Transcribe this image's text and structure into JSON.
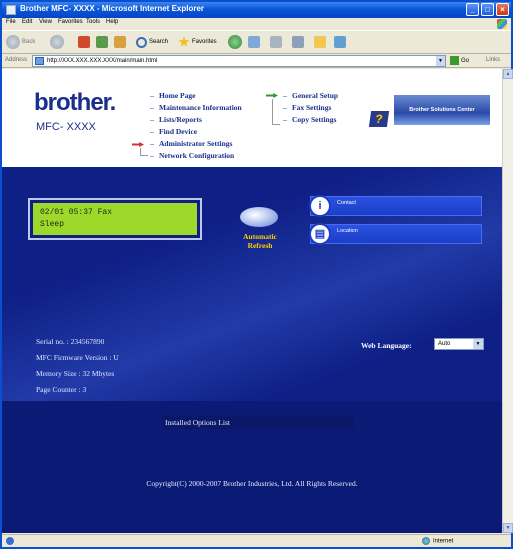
{
  "window": {
    "title": "Brother MFC- XXXX - Microsoft Internet Explorer"
  },
  "menu": [
    "File",
    "Edit",
    "View",
    "Favorites",
    "Tools",
    "Help"
  ],
  "toolbar": {
    "back_label": "Back",
    "search_label": "Search",
    "favorites_label": "Favorites"
  },
  "address": {
    "label": "Address",
    "url": "http://XXX.XXX.XXX.XXX/main/main.html",
    "go_label": "Go",
    "links_label": "Links"
  },
  "header": {
    "logo": "brother.",
    "model": "MFC- XXXX",
    "nav_left": [
      "Home Page",
      "Maintenance Information",
      "Lists/Reports",
      "Find Device",
      "Administrator Settings",
      "Network Configuration"
    ],
    "nav_right": [
      "General Setup",
      "Fax Settings",
      "Copy Settings"
    ],
    "solutions_button": "Brother Solutions Center"
  },
  "device": {
    "lcd_line1": "02/01 05:37 Fax",
    "lcd_line2": "Sleep",
    "refresh_label_1": "Automatic",
    "refresh_label_2": "Refresh",
    "contact_label": "Contact",
    "location_label": "Location",
    "serial": "Serial no. : 234567890",
    "firmware": "MFC  Firmware Version : U",
    "memory": "Memory Size : 32 Mbytes",
    "page_counter": "Page Counter : 3",
    "web_language_label": "Web Language:",
    "web_language_value": "Auto",
    "installed_options": "Installed Options List",
    "copyright": "Copyright(C) 2000-2007 Brother Industries, Ltd. All Rights Reserved."
  },
  "status": {
    "zone": "Internet"
  },
  "colors": {
    "panel_blue": "#0e1f86",
    "lcd_green": "#9ed82a",
    "refresh_yellow": "#ffcc00",
    "titlebar_blue": "#0a56d8"
  }
}
